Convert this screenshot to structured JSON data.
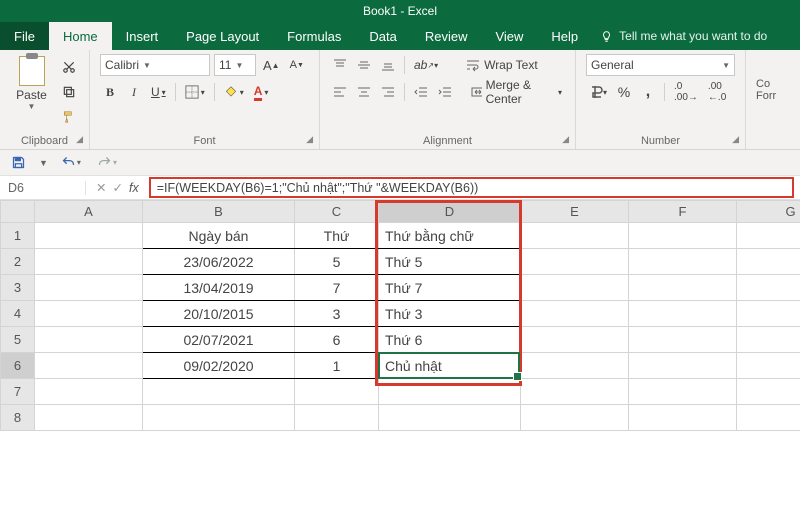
{
  "title": "Book1 - Excel",
  "menu": {
    "file": "File",
    "home": "Home",
    "insert": "Insert",
    "pagelayout": "Page Layout",
    "formulas": "Formulas",
    "data": "Data",
    "review": "Review",
    "view": "View",
    "help": "Help",
    "tellme": "Tell me what you want to do"
  },
  "ribbon": {
    "paste": "Paste",
    "font_name": "Calibri",
    "font_size": "11",
    "wrap": "Wrap Text",
    "merge": "Merge & Center",
    "numfmt": "General",
    "groups": {
      "clipboard": "Clipboard",
      "font": "Font",
      "alignment": "Alignment",
      "number": "Number"
    },
    "cond": "Co\nForr"
  },
  "namebox": "D6",
  "formula": "=IF(WEEKDAY(B6)=1;\"Chủ nhật\";\"Thứ \"&WEEKDAY(B6))",
  "cols": [
    "A",
    "B",
    "C",
    "D",
    "E",
    "F",
    "G"
  ],
  "rows": [
    "1",
    "2",
    "3",
    "4",
    "5",
    "6",
    "7",
    "8"
  ],
  "cells": {
    "B1": "Ngày bán",
    "C1": "Thứ",
    "D1": "Thứ bằng chữ",
    "B2": "23/06/2022",
    "C2": "5",
    "D2": "Thứ 5",
    "B3": "13/04/2019",
    "C3": "7",
    "D3": "Thứ 7",
    "B4": "20/10/2015",
    "C4": "3",
    "D4": "Thứ 3",
    "B5": "02/07/2021",
    "C5": "6",
    "D5": "Thứ 6",
    "B6": "09/02/2020",
    "C6": "1",
    "D6": "Chủ nhật"
  },
  "chart_data": {
    "type": "table",
    "columns": [
      "Ngày bán",
      "Thứ",
      "Thứ bằng chữ"
    ],
    "rows": [
      [
        "23/06/2022",
        5,
        "Thứ 5"
      ],
      [
        "13/04/2019",
        7,
        "Thứ 7"
      ],
      [
        "20/10/2015",
        3,
        "Thứ 3"
      ],
      [
        "02/07/2021",
        6,
        "Thứ 6"
      ],
      [
        "09/02/2020",
        1,
        "Chủ nhật"
      ]
    ]
  }
}
